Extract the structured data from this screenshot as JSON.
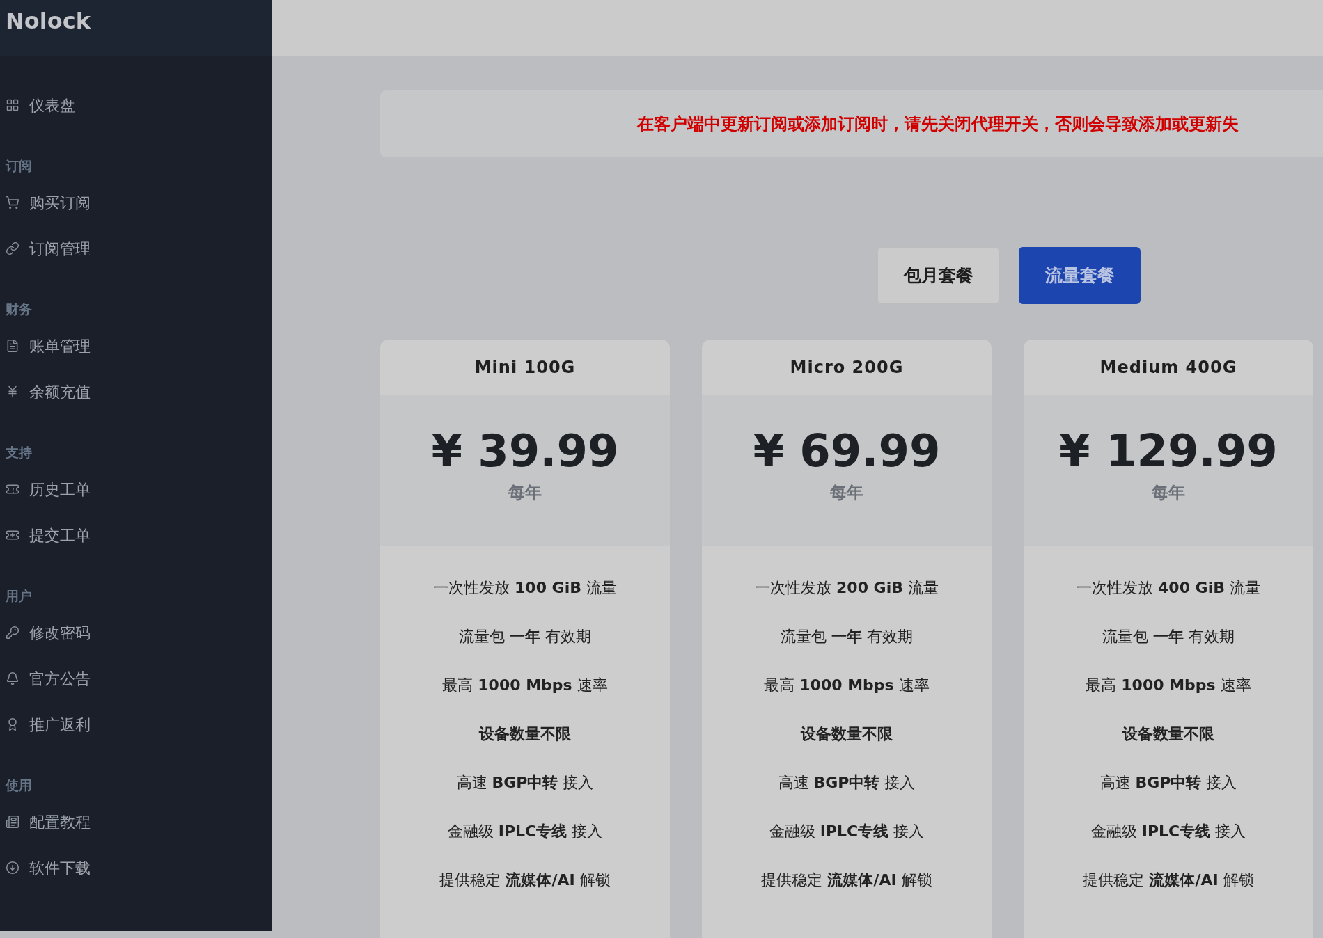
{
  "sidebar": {
    "brand": "Nolock",
    "sections": [
      {
        "items": [
          {
            "label": "仪表盘"
          }
        ]
      },
      {
        "title": "订阅",
        "items": [
          {
            "label": "购买订阅"
          },
          {
            "label": "订阅管理"
          }
        ]
      },
      {
        "title": "财务",
        "items": [
          {
            "label": "账单管理"
          },
          {
            "label": "余额充值"
          }
        ]
      },
      {
        "title": "支持",
        "items": [
          {
            "label": "历史工单"
          },
          {
            "label": "提交工单"
          }
        ]
      },
      {
        "title": "用户",
        "items": [
          {
            "label": "修改密码"
          },
          {
            "label": "官方公告"
          },
          {
            "label": "推广返利"
          }
        ]
      },
      {
        "title": "使用",
        "items": [
          {
            "label": "配置教程"
          },
          {
            "label": "软件下载"
          }
        ]
      }
    ]
  },
  "notice": "在客户端中更新订阅或添加订阅时，请先关闭代理开关，否则会导致添加或更新失",
  "plan_tabs": [
    {
      "label": "包月套餐",
      "selected": false
    },
    {
      "label": "流量套餐",
      "selected": true
    }
  ],
  "plans": [
    {
      "name": "Mini 100G",
      "price": "¥ 39.99",
      "period": "每年",
      "features": [
        "一次性发放 **100 GiB** 流量",
        "流量包 **一年** 有效期",
        "最高 **1000 Mbps** 速率",
        "**设备数量不限**",
        "高速 **BGP中转** 接入",
        "金融级 **IPLC专线** 接入",
        "提供稳定 **流媒体/AI** 解锁"
      ]
    },
    {
      "name": "Micro 200G",
      "price": "¥ 69.99",
      "period": "每年",
      "features": [
        "一次性发放 **200 GiB** 流量",
        "流量包 **一年** 有效期",
        "最高 **1000 Mbps** 速率",
        "**设备数量不限**",
        "高速 **BGP中转** 接入",
        "金融级 **IPLC专线** 接入",
        "提供稳定 **流媒体/AI** 解锁"
      ]
    },
    {
      "name": "Medium 400G",
      "price": "¥ 129.99",
      "period": "每年",
      "features": [
        "一次性发放 **400 GiB** 流量",
        "流量包 **一年** 有效期",
        "最高 **1000 Mbps** 速率",
        "**设备数量不限**",
        "高速 **BGP中转** 接入",
        "金融级 **IPLC专线** 接入",
        "提供稳定 **流媒体/AI** 解锁"
      ]
    }
  ]
}
